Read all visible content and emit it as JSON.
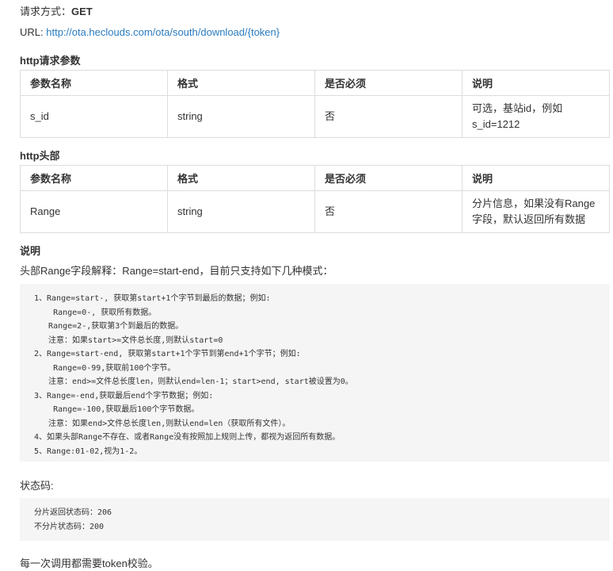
{
  "method": {
    "label": "请求方式：",
    "value": "GET"
  },
  "url": {
    "label": "URL: ",
    "value": "http://ota.heclouds.com/ota/south/download/{token}"
  },
  "params_title": "http请求参数",
  "headers_title": "http头部",
  "columns": [
    "参数名称",
    "格式",
    "是否必须",
    "说明"
  ],
  "params": [
    [
      "s_id",
      "string",
      "否",
      "可选，基站id，例如s_id=1212"
    ]
  ],
  "headers": [
    [
      "Range",
      "string",
      "否",
      "分片信息，如果没有Range字段，默认返回所有数据"
    ]
  ],
  "note_title": "说明",
  "note_text": "头部Range字段解释：Range=start-end，目前只支持如下几种模式：",
  "range_code": "1、Range=start-, 获取第start+1个字节到最后的数据；例如:\n    Range=0-, 获取所有数据。\n   Range=2-,获取第3个到最后的数据。\n   注意：如果start>=文件总长度,则默认start=0\n2、Range=start-end, 获取第start+1个字节到第end+1个字节；例如:\n    Range=0-99,获取前100个字节。\n   注意：end>=文件总长度len，则默认end=len-1；start>end, start被设置为0。\n3、Range=-end,获取最后end个字节数据；例如:\n    Range=-100,获取最后100个字节数据。\n   注意：如果end>文件总长度len,则默认end=len（获取所有文件）。\n4、如果头部Range不存在、或者Range没有按照加上规则上传，都视为返回所有数据。\n5、Range:01-02,视为1-2。",
  "status_title": "状态码:",
  "status_code": "分片返回状态码：206\n不分片状态码：200",
  "footer": "每一次调用都需要token校验。"
}
